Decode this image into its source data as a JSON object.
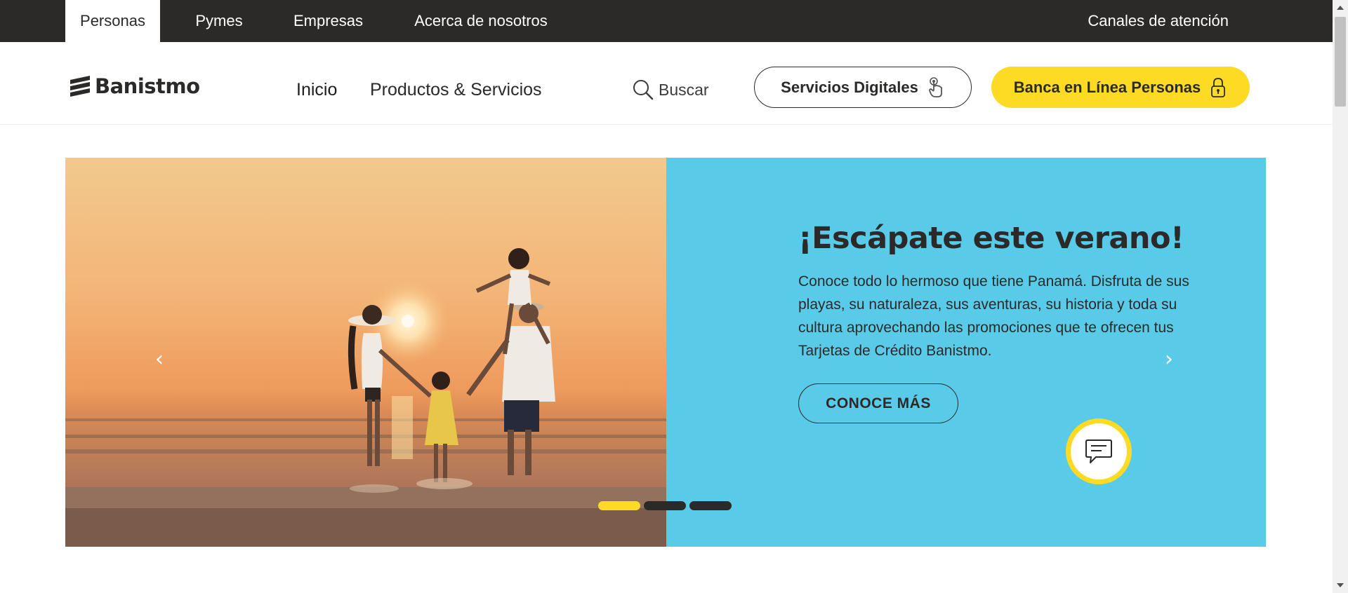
{
  "topbar": {
    "tabs": [
      {
        "label": "Personas",
        "active": true
      },
      {
        "label": "Pymes",
        "active": false
      },
      {
        "label": "Empresas",
        "active": false
      },
      {
        "label": "Acerca de nosotros",
        "active": false
      }
    ],
    "canales": "Canales de atención"
  },
  "header": {
    "logo_text": "Banistmo",
    "nav": [
      {
        "label": "Inicio"
      },
      {
        "label": "Productos & Servicios"
      }
    ],
    "search_label": "Buscar",
    "servicios_digitales": "Servicios Digitales",
    "banca_en_linea": "Banca en Línea Personas"
  },
  "hero": {
    "title": "¡Escápate este verano!",
    "text": "Conoce todo lo hermoso que tiene Panamá. Disfruta de sus playas, su naturaleza, sus aventuras, su historia y toda su cultura aprovechando las promociones que te ofrecen tus Tarjetas de Crédito Banistmo.",
    "cta": "CONOCE MÁS",
    "prev_arrow": "‹",
    "next_arrow": "›",
    "slides": 3,
    "active_slide": 1
  },
  "colors": {
    "dark": "#2c2a29",
    "brand_yellow": "#fdda24",
    "hero_blue": "#59cbe8"
  },
  "icons": {
    "search": "search-icon",
    "touch": "touch-icon",
    "lock": "lock-icon",
    "chat": "chat-icon"
  }
}
